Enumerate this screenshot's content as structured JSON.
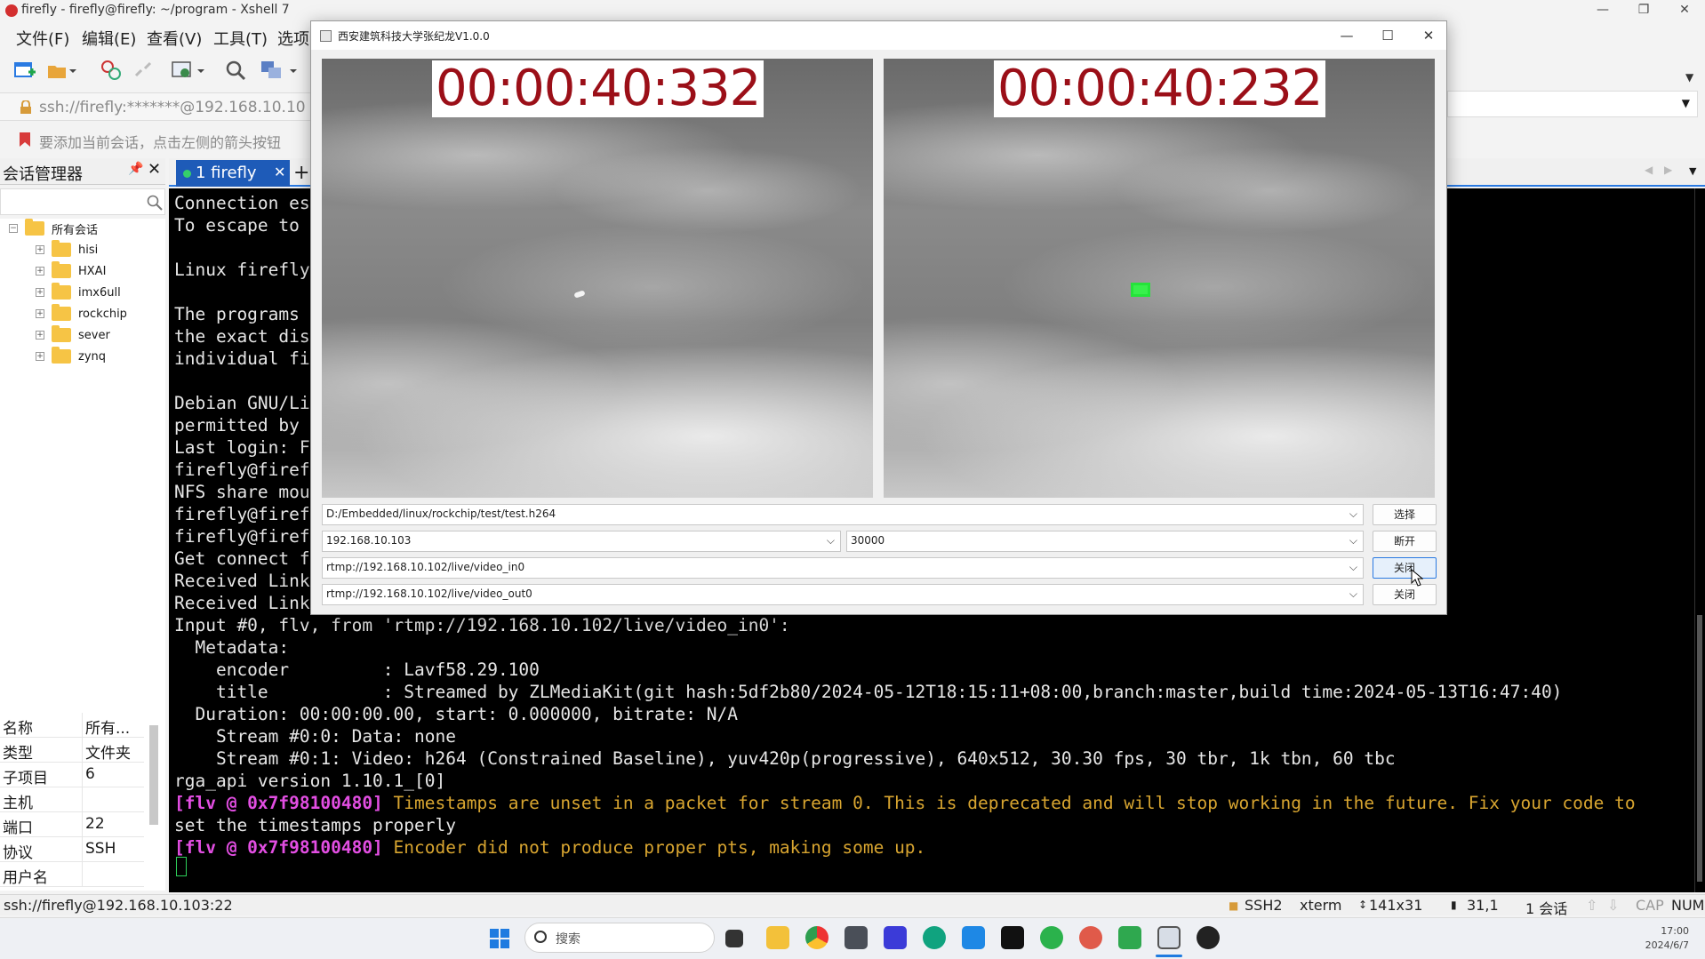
{
  "xshell": {
    "title": "firefly - firefly@firefly: ~/program - Xshell 7",
    "menu": [
      "文件(F)",
      "编辑(E)",
      "查看(V)",
      "工具(T)",
      "选项"
    ],
    "address": "ssh://firefly:*******@192.168.10.10",
    "hint": "要添加当前会话，点击左侧的箭头按钮"
  },
  "sessions": {
    "title": "会话管理器",
    "root": "所有会话",
    "folders": [
      "hisi",
      "HXAI",
      "imx6ull",
      "rockchip",
      "sever",
      "zynq"
    ]
  },
  "properties": [
    {
      "k": "名称",
      "v": "所有..."
    },
    {
      "k": "类型",
      "v": "文件夹"
    },
    {
      "k": "子项目",
      "v": "6"
    },
    {
      "k": "主机",
      "v": ""
    },
    {
      "k": "端口",
      "v": "22"
    },
    {
      "k": "协议",
      "v": "SSH"
    },
    {
      "k": "用户名",
      "v": ""
    }
  ],
  "tab": {
    "label": "1 firefly"
  },
  "terminal": {
    "left_lines": [
      "Connection es",
      "To escape to",
      "",
      "Linux firefly",
      "",
      "The programs",
      "the exact dis",
      "individual fi",
      "",
      "Debian GNU/Li",
      "permitted by",
      "Last login: F",
      "firefly@firef",
      "NFS share mou",
      "firefly@firef",
      "firefly@firef",
      "Get connect f",
      "Received Link",
      "Received Link"
    ],
    "lines": [
      "Input #0, flv, from 'rtmp://192.168.10.102/live/video_in0':",
      "  Metadata:",
      "    encoder         : Lavf58.29.100",
      "    title           : Streamed by ZLMediaKit(git hash:5df2b80/2024-05-12T18:15:11+08:00,branch:master,build time:2024-05-13T16:47:40)",
      "  Duration: 00:00:00.00, start: 0.000000, bitrate: N/A",
      "    Stream #0:0: Data: none",
      "    Stream #0:1: Video: h264 (Constrained Baseline), yuv420p(progressive), 640x512, 30.30 fps, 30 tbr, 1k tbn, 60 tbc",
      "rga_api version 1.10.1_[0]"
    ],
    "warn_tag": "[flv @ 0x7f98100480]",
    "warn1": " Timestamps are unset in a packet for stream 0. This is deprecated and will stop working in the future. Fix your code to",
    "warn1b": "set the timestamps properly",
    "warn2": " Encoder did not produce proper pts, making some up."
  },
  "status": {
    "conn": "ssh://firefly@192.168.10.103:22",
    "proto": "SSH2",
    "term": "xterm",
    "size": "141x31",
    "pos": "31,1",
    "sessions": "1 会话",
    "cap": "CAP",
    "num": "NUM"
  },
  "taskbar": {
    "search": "搜索",
    "time": "17:00",
    "date": "2024/6/7"
  },
  "app": {
    "title": "西安建筑科技大学张纪龙V1.0.0",
    "video_left_time": "00:00:40:332",
    "video_right_time": "00:00:40:232",
    "file_path": "D:/Embedded/linux/rockchip/test/test.h264",
    "ip": "192.168.10.103",
    "port": "30000",
    "rtmp_in": "rtmp://192.168.10.102/live/video_in0",
    "rtmp_out": "rtmp://192.168.10.102/live/video_out0",
    "btn_select": "选择",
    "btn_disconnect": "断开",
    "btn_close1": "关闭",
    "btn_close2": "关闭"
  },
  "colors": {
    "accent": "#1e5bb8",
    "timestamp": "#9b0f18",
    "target_box": "#25e43a",
    "warn_tag": "#e24ee2",
    "warn_text": "#d8a530"
  }
}
